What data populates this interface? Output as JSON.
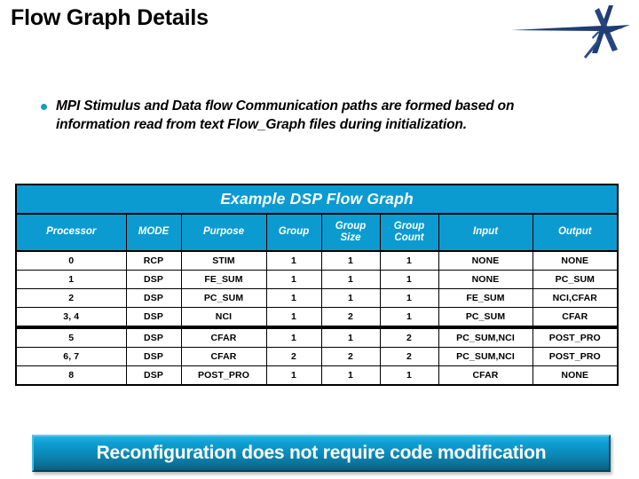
{
  "slide": {
    "title": "Flow Graph Details",
    "logo_name": "lockheed-martin-star-logo"
  },
  "bullet": {
    "text": "MPI Stimulus and Data flow Communication paths are formed based on information read from text Flow_Graph files during initialization.",
    "marker_color": "#1a9bbd"
  },
  "table": {
    "title": "Example DSP Flow Graph",
    "header_bg": "#0b9bd1",
    "header_text_color": "#ffffff",
    "columns": [
      "Processor",
      "MODE",
      "Purpose",
      "Group",
      "Group Size",
      "Group Count",
      "Input",
      "Output"
    ],
    "column_lines": [
      [
        "Processor"
      ],
      [
        "MODE"
      ],
      [
        "Purpose"
      ],
      [
        "Group"
      ],
      [
        "Group",
        "Size"
      ],
      [
        "Group",
        "Count"
      ],
      [
        "Input"
      ],
      [
        "Output"
      ]
    ],
    "rows": [
      {
        "processor": "0",
        "mode": "RCP",
        "purpose": "STIM",
        "group": "1",
        "group_size": "1",
        "group_count": "1",
        "input": "NONE",
        "output": "NONE",
        "gap_above": false
      },
      {
        "processor": "1",
        "mode": "DSP",
        "purpose": "FE_SUM",
        "group": "1",
        "group_size": "1",
        "group_count": "1",
        "input": "NONE",
        "output": "PC_SUM",
        "gap_above": false
      },
      {
        "processor": "2",
        "mode": "DSP",
        "purpose": "PC_SUM",
        "group": "1",
        "group_size": "1",
        "group_count": "1",
        "input": "FE_SUM",
        "output": "NCI,CFAR",
        "gap_above": false
      },
      {
        "processor": "3, 4",
        "mode": "DSP",
        "purpose": "NCI",
        "group": "1",
        "group_size": "2",
        "group_count": "1",
        "input": "PC_SUM",
        "output": "CFAR",
        "gap_above": false
      },
      {
        "processor": "5",
        "mode": "DSP",
        "purpose": "CFAR",
        "group": "1",
        "group_size": "1",
        "group_count": "2",
        "input": "PC_SUM,NCI",
        "output": "POST_PRO",
        "gap_above": true
      },
      {
        "processor": "6, 7",
        "mode": "DSP",
        "purpose": "CFAR",
        "group": "2",
        "group_size": "2",
        "group_count": "2",
        "input": "PC_SUM,NCI",
        "output": "POST_PRO",
        "gap_above": false
      },
      {
        "processor": "8",
        "mode": "DSP",
        "purpose": "POST_PRO",
        "group": "1",
        "group_size": "1",
        "group_count": "1",
        "input": "CFAR",
        "output": "NONE",
        "gap_above": false
      }
    ]
  },
  "banner": {
    "text": "Reconfiguration does not require code modification",
    "gradient_top": "#1fb6e0",
    "gradient_bottom": "#0a5f7e",
    "text_color": "#ffffff"
  }
}
